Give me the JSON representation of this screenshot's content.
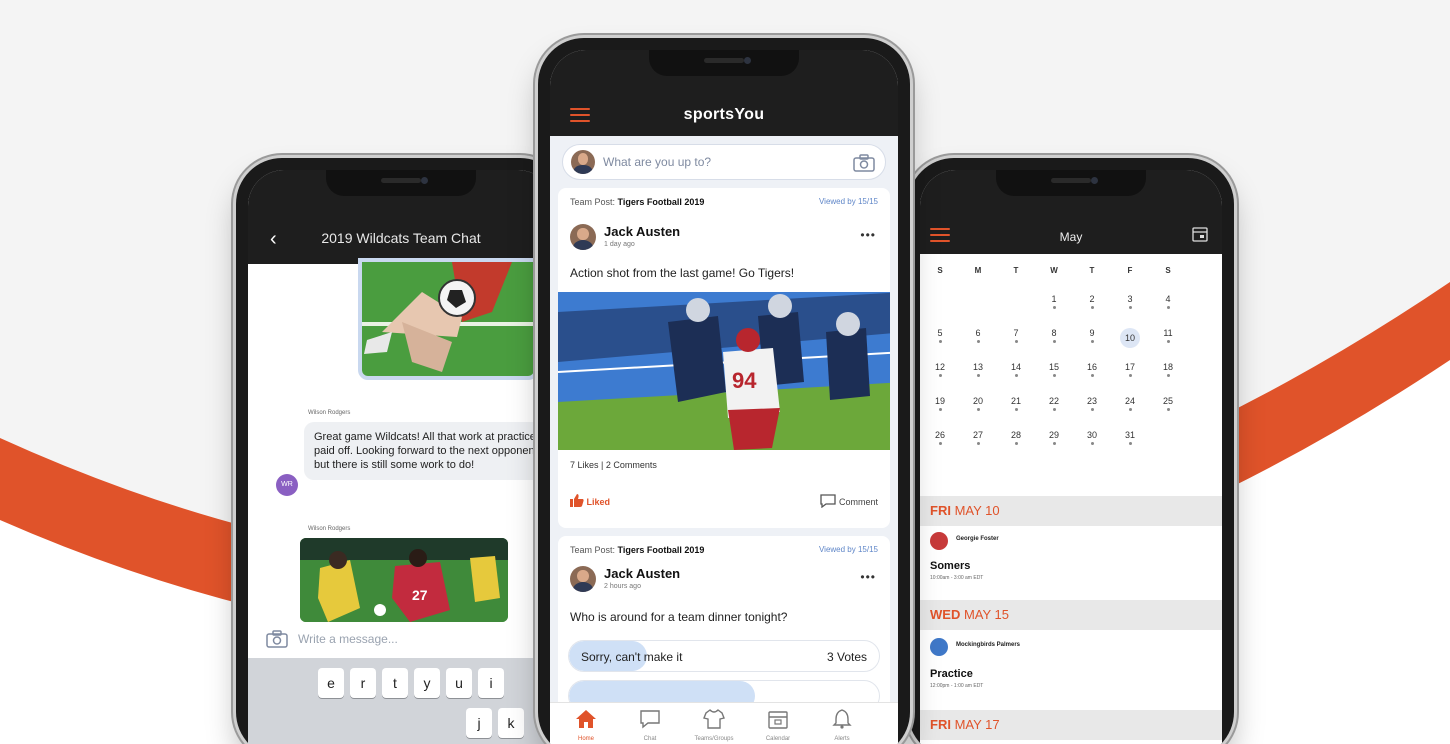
{
  "colors": {
    "accent": "#e0532a",
    "topbar": "#1e1e1e",
    "feed_bg": "#eef1f6",
    "link_blue": "#5f86c8"
  },
  "left_phone": {
    "title": "2019 Wildcats Team Chat",
    "back_icon": "chevron-left-icon",
    "sender_1": "Wilson Rodgers",
    "message_1": "Great game Wildcats! All that work at practice paid off. Looking forward to the next opponent but there is still some work to do!",
    "avatar_initials": "WR",
    "sender_2": "Wilson Rodgers",
    "composer_placeholder": "Write a message...",
    "keyboard_row": [
      "e",
      "r",
      "t",
      "y",
      "u",
      "i"
    ],
    "keyboard_row_2": [
      "j",
      "k"
    ]
  },
  "center_phone": {
    "brand": "sportsYou",
    "composer_placeholder": "What are you up to?",
    "post_1": {
      "meta_prefix": "Team Post:",
      "meta_team": "Tigers Football 2019",
      "viewed": "Viewed by 15/15",
      "author": "Jack Austen",
      "ago": "1 day ago",
      "text": "Action shot from the last game! Go Tigers!",
      "likes": "7 Likes",
      "separator": "|",
      "comments": "2 Comments",
      "liked_label": "Liked",
      "comment_label": "Comment"
    },
    "post_2": {
      "meta_prefix": "Team Post:",
      "meta_team": "Tigers Football 2019",
      "viewed": "Viewed by 15/15",
      "author": "Jack Austen",
      "ago": "2 hours ago",
      "text": "Who is around for a team dinner tonight?",
      "poll_option": "Sorry, can't make it",
      "poll_votes": "3 Votes",
      "poll_fraction": 0.25
    },
    "tabs": [
      {
        "label": "Home",
        "icon": "home-icon"
      },
      {
        "label": "Chat",
        "icon": "chat-icon"
      },
      {
        "label": "Teams/Groups",
        "icon": "jersey-icon"
      },
      {
        "label": "Calendar",
        "icon": "calendar-icon"
      },
      {
        "label": "Alerts",
        "icon": "bell-icon"
      }
    ]
  },
  "right_phone": {
    "month": "May",
    "weekdays": [
      "S",
      "M",
      "T",
      "W",
      "T",
      "F",
      "S"
    ],
    "weeks": [
      [
        "",
        "",
        "",
        "1",
        "2",
        "3",
        "4"
      ],
      [
        "5",
        "6",
        "7",
        "8",
        "9",
        "10",
        "11"
      ],
      [
        "12",
        "13",
        "14",
        "15",
        "16",
        "17",
        "18"
      ],
      [
        "19",
        "20",
        "21",
        "22",
        "23",
        "24",
        "25"
      ],
      [
        "26",
        "27",
        "28",
        "29",
        "30",
        "31",
        ""
      ]
    ],
    "selected_day": "10",
    "section_1": {
      "day": "FRI",
      "date": "MAY 10"
    },
    "event_1": {
      "who": "Georgie Foster",
      "title": "Somers",
      "time": "10:00am - 3:00 am EDT"
    },
    "section_2": {
      "day": "WED",
      "date": "MAY 15"
    },
    "event_2": {
      "who": "Mockingbirds Palmers",
      "title": "Practice",
      "time": "12:00pm - 1:00 am EDT"
    },
    "section_3": {
      "day": "FRI",
      "date": "MAY 17"
    }
  }
}
